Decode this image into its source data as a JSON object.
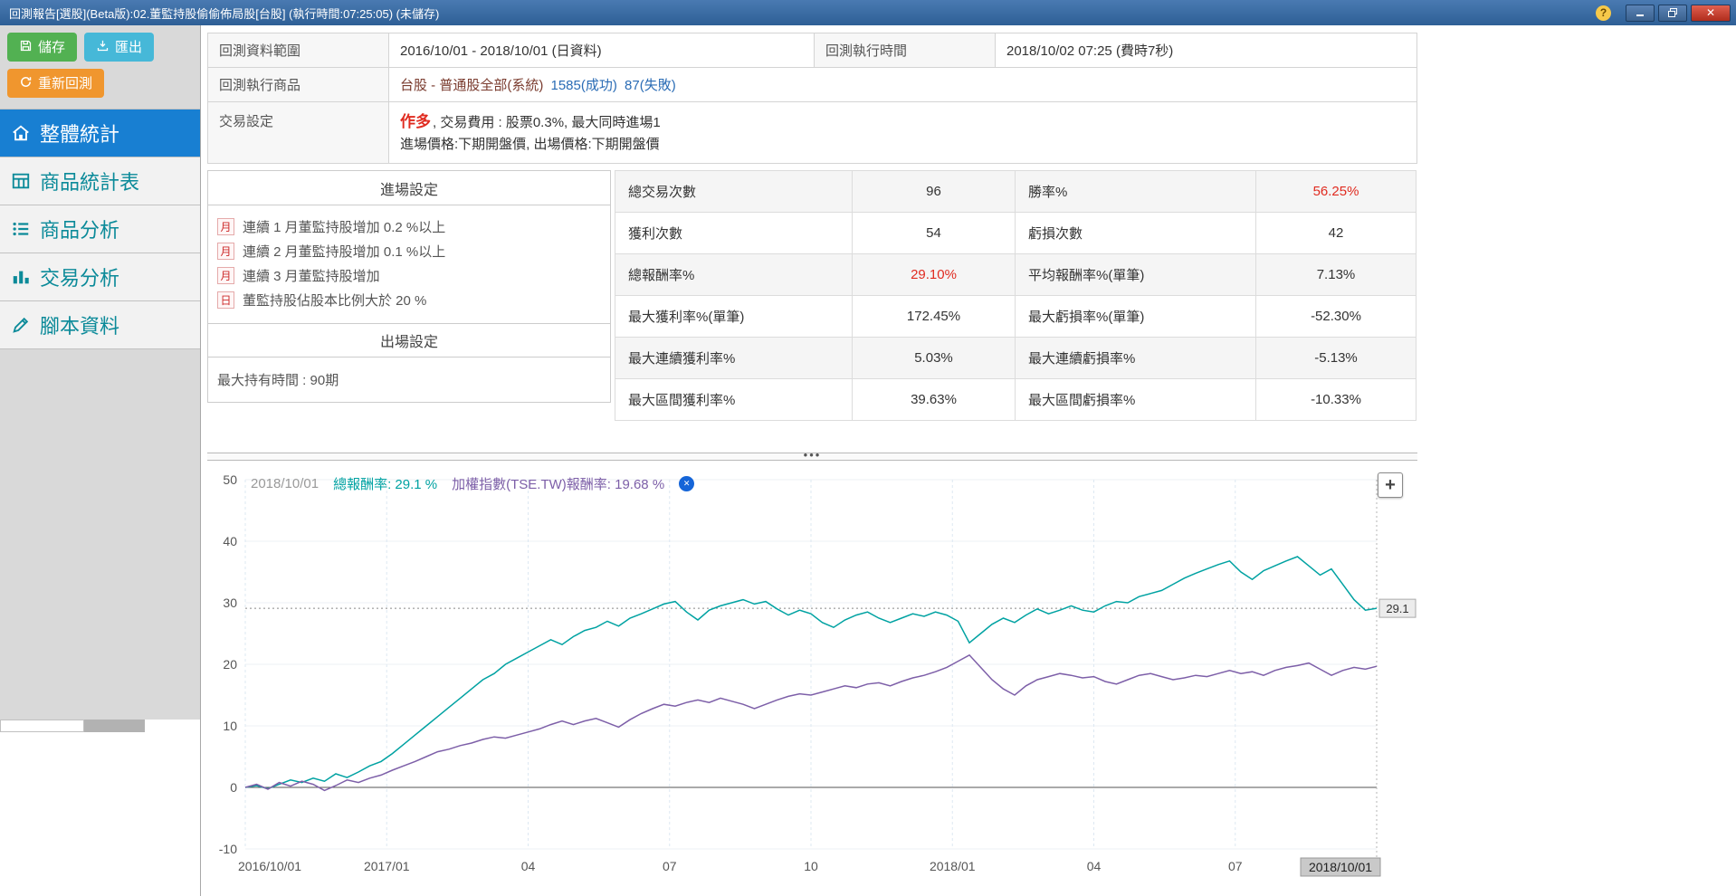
{
  "titlebar": {
    "title": "回測報告[選股](Beta版):02.董監持股偷偷佈局股[台股] (執行時間:07:25:05) (未儲存)",
    "help": "?",
    "close": "✕"
  },
  "sidebar": {
    "save": "儲存",
    "export": "匯出",
    "rerun": "重新回測",
    "nav": [
      "整體統計",
      "商品統計表",
      "商品分析",
      "交易分析",
      "腳本資料"
    ]
  },
  "info": {
    "range_label": "回測資料範圍",
    "range_value": "2016/10/01 - 2018/10/01 (日資料)",
    "exec_label": "回測執行時間",
    "exec_value": "2018/10/02 07:25 (費時7秒)",
    "product_label": "回測執行商品",
    "product_value": "台股 - 普通股全部(系統)",
    "success": "1585(成功)",
    "fail": "87(失敗)",
    "trade_label": "交易設定",
    "direction": "作多",
    "trade_rest": ", 交易費用 : 股票0.3%, 最大同時進場1",
    "trade_line2": "進場價格:下期開盤價, 出場價格:下期開盤價"
  },
  "entry": {
    "title": "進場設定",
    "conditions": [
      {
        "badge": "月",
        "text": "連續 1 月董監持股增加 0.2 %以上"
      },
      {
        "badge": "月",
        "text": "連續 2 月董監持股增加 0.1 %以上"
      },
      {
        "badge": "月",
        "text": "連續 3 月董監持股增加"
      },
      {
        "badge": "日",
        "text": "董監持股佔股本比例大於 20 %"
      }
    ],
    "exit_title": "出場設定",
    "exit_rule": "最大持有時間 : 90期"
  },
  "stats": {
    "rows": [
      {
        "l1": "總交易次數",
        "v1": "96",
        "l2": "勝率%",
        "v2": "56.25%"
      },
      {
        "l1": "獲利次數",
        "v1": "54",
        "l2": "虧損次數",
        "v2": "42"
      },
      {
        "l1": "總報酬率%",
        "v1": "29.10%",
        "l2": "平均報酬率%(單筆)",
        "v2": "7.13%"
      },
      {
        "l1": "最大獲利率%(單筆)",
        "v1": "172.45%",
        "l2": "最大虧損率%(單筆)",
        "v2": "-52.30%"
      },
      {
        "l1": "最大連續獲利率%",
        "v1": "5.03%",
        "l2": "最大連續虧損率%",
        "v2": "-5.13%"
      },
      {
        "l1": "最大區間獲利率%",
        "v1": "39.63%",
        "l2": "最大區間虧損率%",
        "v2": "-10.33%"
      }
    ]
  },
  "splitter_dots": "•••",
  "chart_data": {
    "type": "line",
    "header_date": "2018/10/01",
    "legend": [
      {
        "text": "總報酬率: 29.1 %",
        "color": "#00a2a2"
      },
      {
        "text": "加權指數(TSE.TW)報酬率: 19.68 %",
        "color": "#7d5fa8"
      }
    ],
    "zoom_button": "+",
    "ylim": [
      -10,
      50
    ],
    "yticks": [
      50,
      40,
      30,
      20,
      10,
      0,
      -10
    ],
    "xticks": [
      {
        "pos": 0,
        "label": "2016/10/01"
      },
      {
        "pos": 0.125,
        "label": "2017/01"
      },
      {
        "pos": 0.25,
        "label": "04"
      },
      {
        "pos": 0.375,
        "label": "07"
      },
      {
        "pos": 0.5,
        "label": "10"
      },
      {
        "pos": 0.625,
        "label": "2018/01"
      },
      {
        "pos": 0.75,
        "label": "04"
      },
      {
        "pos": 0.875,
        "label": "07"
      }
    ],
    "hline": {
      "value": 29.1,
      "label": "29.1"
    },
    "end_label": "2018/10/01",
    "series": [
      {
        "name": "總報酬率",
        "color": "#00a2a2",
        "final": 29.1,
        "points": [
          [
            0,
            0
          ],
          [
            0.01,
            0.3
          ],
          [
            0.02,
            -0.2
          ],
          [
            0.03,
            0.5
          ],
          [
            0.04,
            1.2
          ],
          [
            0.05,
            0.8
          ],
          [
            0.06,
            1.5
          ],
          [
            0.07,
            1
          ],
          [
            0.08,
            2.2
          ],
          [
            0.09,
            1.6
          ],
          [
            0.1,
            2.5
          ],
          [
            0.11,
            3.5
          ],
          [
            0.12,
            4.2
          ],
          [
            0.13,
            5.5
          ],
          [
            0.14,
            7
          ],
          [
            0.15,
            8.5
          ],
          [
            0.16,
            10
          ],
          [
            0.17,
            11.5
          ],
          [
            0.18,
            13
          ],
          [
            0.19,
            14.5
          ],
          [
            0.2,
            16
          ],
          [
            0.21,
            17.5
          ],
          [
            0.22,
            18.5
          ],
          [
            0.23,
            20
          ],
          [
            0.24,
            21
          ],
          [
            0.25,
            22
          ],
          [
            0.26,
            23
          ],
          [
            0.27,
            24
          ],
          [
            0.28,
            23.2
          ],
          [
            0.29,
            24.5
          ],
          [
            0.3,
            25.5
          ],
          [
            0.31,
            26
          ],
          [
            0.32,
            27
          ],
          [
            0.33,
            26.2
          ],
          [
            0.34,
            27.5
          ],
          [
            0.35,
            28.2
          ],
          [
            0.36,
            29
          ],
          [
            0.37,
            29.8
          ],
          [
            0.38,
            30.2
          ],
          [
            0.39,
            28.5
          ],
          [
            0.4,
            27.2
          ],
          [
            0.41,
            28.8
          ],
          [
            0.42,
            29.5
          ],
          [
            0.43,
            30
          ],
          [
            0.44,
            30.5
          ],
          [
            0.45,
            29.8
          ],
          [
            0.46,
            30.2
          ],
          [
            0.47,
            29
          ],
          [
            0.48,
            28
          ],
          [
            0.49,
            28.8
          ],
          [
            0.5,
            28.2
          ],
          [
            0.51,
            26.8
          ],
          [
            0.52,
            26
          ],
          [
            0.53,
            27.2
          ],
          [
            0.54,
            28
          ],
          [
            0.55,
            28.5
          ],
          [
            0.56,
            27.5
          ],
          [
            0.57,
            26.8
          ],
          [
            0.58,
            27.5
          ],
          [
            0.59,
            28.2
          ],
          [
            0.6,
            27.8
          ],
          [
            0.61,
            28.5
          ],
          [
            0.62,
            28
          ],
          [
            0.63,
            27
          ],
          [
            0.64,
            23.5
          ],
          [
            0.65,
            25
          ],
          [
            0.66,
            26.5
          ],
          [
            0.67,
            27.5
          ],
          [
            0.68,
            26.8
          ],
          [
            0.69,
            28
          ],
          [
            0.7,
            29
          ],
          [
            0.71,
            28.2
          ],
          [
            0.72,
            28.8
          ],
          [
            0.73,
            29.5
          ],
          [
            0.74,
            28.8
          ],
          [
            0.75,
            28.5
          ],
          [
            0.76,
            29.5
          ],
          [
            0.77,
            30.2
          ],
          [
            0.78,
            30
          ],
          [
            0.79,
            31
          ],
          [
            0.8,
            31.5
          ],
          [
            0.81,
            32
          ],
          [
            0.82,
            33
          ],
          [
            0.83,
            34
          ],
          [
            0.84,
            34.8
          ],
          [
            0.85,
            35.5
          ],
          [
            0.86,
            36.2
          ],
          [
            0.87,
            36.8
          ],
          [
            0.88,
            35
          ],
          [
            0.89,
            33.8
          ],
          [
            0.9,
            35.2
          ],
          [
            0.91,
            36
          ],
          [
            0.92,
            36.8
          ],
          [
            0.93,
            37.5
          ],
          [
            0.94,
            36
          ],
          [
            0.95,
            34.5
          ],
          [
            0.96,
            35.5
          ],
          [
            0.97,
            33
          ],
          [
            0.98,
            30.5
          ],
          [
            0.99,
            28.8
          ],
          [
            1,
            29.1
          ]
        ]
      },
      {
        "name": "加權指數(TSE.TW)報酬率",
        "color": "#7d5fa8",
        "final": 19.68,
        "points": [
          [
            0,
            0
          ],
          [
            0.01,
            0.5
          ],
          [
            0.02,
            -0.3
          ],
          [
            0.03,
            0.8
          ],
          [
            0.04,
            0.2
          ],
          [
            0.05,
            1
          ],
          [
            0.06,
            0.5
          ],
          [
            0.07,
            -0.5
          ],
          [
            0.08,
            0.3
          ],
          [
            0.09,
            1.2
          ],
          [
            0.1,
            0.8
          ],
          [
            0.11,
            1.5
          ],
          [
            0.12,
            2
          ],
          [
            0.13,
            2.8
          ],
          [
            0.14,
            3.5
          ],
          [
            0.15,
            4.2
          ],
          [
            0.16,
            5
          ],
          [
            0.17,
            5.8
          ],
          [
            0.18,
            6.2
          ],
          [
            0.19,
            6.8
          ],
          [
            0.2,
            7.2
          ],
          [
            0.21,
            7.8
          ],
          [
            0.22,
            8.2
          ],
          [
            0.23,
            8
          ],
          [
            0.24,
            8.5
          ],
          [
            0.25,
            9
          ],
          [
            0.26,
            9.5
          ],
          [
            0.27,
            10.2
          ],
          [
            0.28,
            10.8
          ],
          [
            0.29,
            10.2
          ],
          [
            0.3,
            10.8
          ],
          [
            0.31,
            11.2
          ],
          [
            0.32,
            10.5
          ],
          [
            0.33,
            9.8
          ],
          [
            0.34,
            11
          ],
          [
            0.35,
            12
          ],
          [
            0.36,
            12.8
          ],
          [
            0.37,
            13.5
          ],
          [
            0.38,
            13.2
          ],
          [
            0.39,
            13.8
          ],
          [
            0.4,
            14.2
          ],
          [
            0.41,
            13.8
          ],
          [
            0.42,
            14.5
          ],
          [
            0.43,
            14
          ],
          [
            0.44,
            13.5
          ],
          [
            0.45,
            12.8
          ],
          [
            0.46,
            13.5
          ],
          [
            0.47,
            14.2
          ],
          [
            0.48,
            14.8
          ],
          [
            0.49,
            15.2
          ],
          [
            0.5,
            15
          ],
          [
            0.51,
            15.5
          ],
          [
            0.52,
            16
          ],
          [
            0.53,
            16.5
          ],
          [
            0.54,
            16.2
          ],
          [
            0.55,
            16.8
          ],
          [
            0.56,
            17
          ],
          [
            0.57,
            16.5
          ],
          [
            0.58,
            17.2
          ],
          [
            0.59,
            17.8
          ],
          [
            0.6,
            18.2
          ],
          [
            0.61,
            18.8
          ],
          [
            0.62,
            19.5
          ],
          [
            0.63,
            20.5
          ],
          [
            0.64,
            21.5
          ],
          [
            0.65,
            19.5
          ],
          [
            0.66,
            17.5
          ],
          [
            0.67,
            16
          ],
          [
            0.68,
            15
          ],
          [
            0.69,
            16.5
          ],
          [
            0.7,
            17.5
          ],
          [
            0.71,
            18
          ],
          [
            0.72,
            18.5
          ],
          [
            0.73,
            18.2
          ],
          [
            0.74,
            17.8
          ],
          [
            0.75,
            18
          ],
          [
            0.76,
            17.2
          ],
          [
            0.77,
            16.8
          ],
          [
            0.78,
            17.5
          ],
          [
            0.79,
            18.2
          ],
          [
            0.8,
            18.5
          ],
          [
            0.81,
            18
          ],
          [
            0.82,
            17.5
          ],
          [
            0.83,
            17.8
          ],
          [
            0.84,
            18.2
          ],
          [
            0.85,
            18
          ],
          [
            0.86,
            18.5
          ],
          [
            0.87,
            19
          ],
          [
            0.88,
            18.5
          ],
          [
            0.89,
            18.8
          ],
          [
            0.9,
            18.2
          ],
          [
            0.91,
            19
          ],
          [
            0.92,
            19.5
          ],
          [
            0.93,
            19.8
          ],
          [
            0.94,
            20.2
          ],
          [
            0.95,
            19.2
          ],
          [
            0.96,
            18.2
          ],
          [
            0.97,
            19
          ],
          [
            0.98,
            19.5
          ],
          [
            0.99,
            19.2
          ],
          [
            1,
            19.68
          ]
        ]
      }
    ]
  }
}
